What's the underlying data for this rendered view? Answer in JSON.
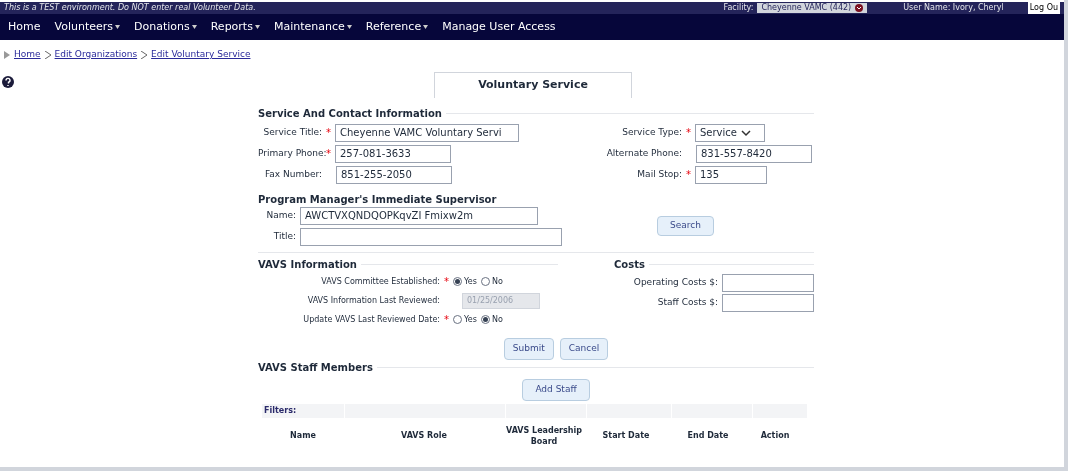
{
  "banner": {
    "notice": "This is a TEST environment. Do NOT enter real Volunteer Data.",
    "facility_label": "Facility:",
    "facility_value": "Cheyenne VAMC (442)",
    "user": "User Name: Ivory, Cheryl",
    "logout": "Log Ou"
  },
  "nav": [
    {
      "label": "Home",
      "has_menu": false
    },
    {
      "label": "Volunteers",
      "has_menu": true
    },
    {
      "label": "Donations",
      "has_menu": true
    },
    {
      "label": "Reports",
      "has_menu": true
    },
    {
      "label": "Maintenance",
      "has_menu": true
    },
    {
      "label": "Reference",
      "has_menu": true
    },
    {
      "label": "Manage User Access",
      "has_menu": false
    }
  ],
  "required_mark": "*",
  "breadcrumbs": [
    "Home",
    "Edit Organizations",
    "Edit Voluntary Service"
  ],
  "tabs": [
    {
      "label": "Voluntary Service",
      "selected": true
    }
  ],
  "service_contact": {
    "title": "Service And Contact Information",
    "left_fields": [
      {
        "label": "Service Title:",
        "required": true,
        "value": "Cheyenne VAMC Voluntary Servi"
      },
      {
        "label": "Primary Phone:",
        "required": true,
        "value": "257-081-3633"
      },
      {
        "label": "Fax Number:",
        "required": false,
        "value": "851-255-2050"
      }
    ],
    "right_fields": [
      {
        "kind": "select",
        "label": "Service Type:",
        "required": true,
        "value": "Service"
      },
      {
        "kind": "text",
        "label": "Alternate Phone:",
        "required": false,
        "value": "831-557-8420"
      },
      {
        "kind": "text",
        "label": "Mail Stop:",
        "required": true,
        "value": "135"
      }
    ]
  },
  "supervisor": {
    "title": "Program Manager's Immediate Supervisor",
    "fields": [
      {
        "label": "Name:",
        "value": "AWCTVXQNDQOPKqvZI Fmixw2m"
      },
      {
        "label": "Title:"
      }
    ],
    "search_button": "Search"
  },
  "vavs_info": {
    "title": "VAVS Information",
    "rows": [
      {
        "kind": "radio",
        "label": "VAVS Committee Established:",
        "required": true,
        "options": [
          {
            "label": "Yes",
            "selected": true
          },
          {
            "label": "No",
            "selected": false
          }
        ]
      },
      {
        "kind": "date",
        "label": "VAVS Information Last Reviewed:",
        "required": false,
        "value": "01/25/2006",
        "disabled": true
      },
      {
        "kind": "radio",
        "label": "Update VAVS Last Reviewed Date:",
        "required": true,
        "options": [
          {
            "label": "Yes",
            "selected": false
          },
          {
            "label": "No",
            "selected": true
          }
        ]
      }
    ]
  },
  "costs": {
    "title": "Costs",
    "fields": [
      {
        "label": "Operating Costs $:"
      },
      {
        "label": "Staff Costs $:"
      }
    ]
  },
  "buttons": [
    "Submit",
    "Cancel"
  ],
  "staff": {
    "title": "VAVS Staff Members",
    "add_button": "Add Staff",
    "filter_label": "Filters:",
    "columns": [
      "Name",
      "VAVS Role",
      "VAVS Leadership Board",
      "Start Date",
      "End Date",
      "Action"
    ]
  }
}
